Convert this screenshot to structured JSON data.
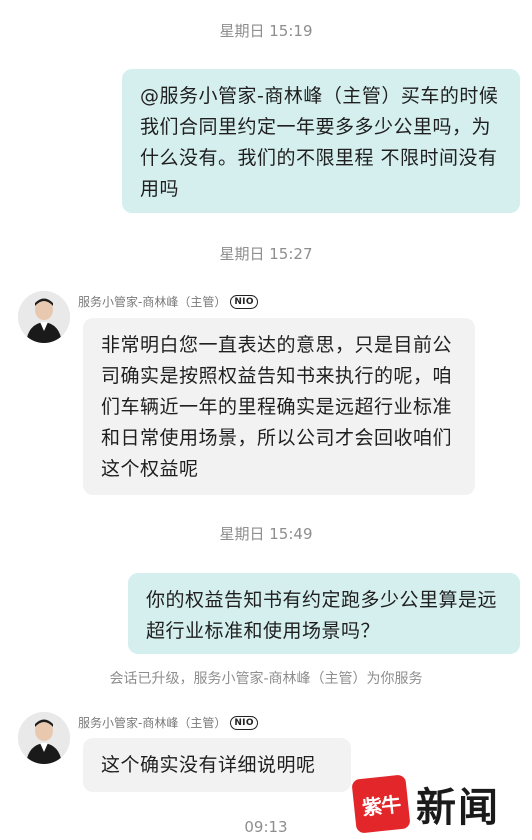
{
  "messages": {
    "ts1": "星期日 15:19",
    "msg1": "@服务小管家-商林峰（主管）买车的时候我们合同里约定一年要多多少公里吗，为什么没有。我们的不限里程 不限时间没有用吗",
    "ts2": "星期日 15:27",
    "sender1": "服务小管家-商林峰（主管）",
    "badge1": "NIO",
    "msg2": "非常明白您一直表达的意思，只是目前公司确实是按照权益告知书来执行的呢，咱们车辆近一年的里程确实是远超行业标准和日常使用场景，所以公司才会回收咱们这个权益呢",
    "ts3": "星期日 15:49",
    "msg3": "你的权益告知书有约定跑多少公里算是远超行业标准和使用场景吗？",
    "system_notice": "会话已升级，服务小管家-商林峰（主管）为你服务",
    "sender2": "服务小管家-商林峰（主管）",
    "badge2": "NIO",
    "msg4": "这个确实没有详细说明呢",
    "ts4": "09:13"
  },
  "watermark": {
    "logo_text": "紫牛",
    "text": "新闻"
  },
  "colors": {
    "outgoing_bubble": "#d5efef",
    "incoming_bubble": "#f2f2f2",
    "watermark_red": "#e3262a"
  }
}
